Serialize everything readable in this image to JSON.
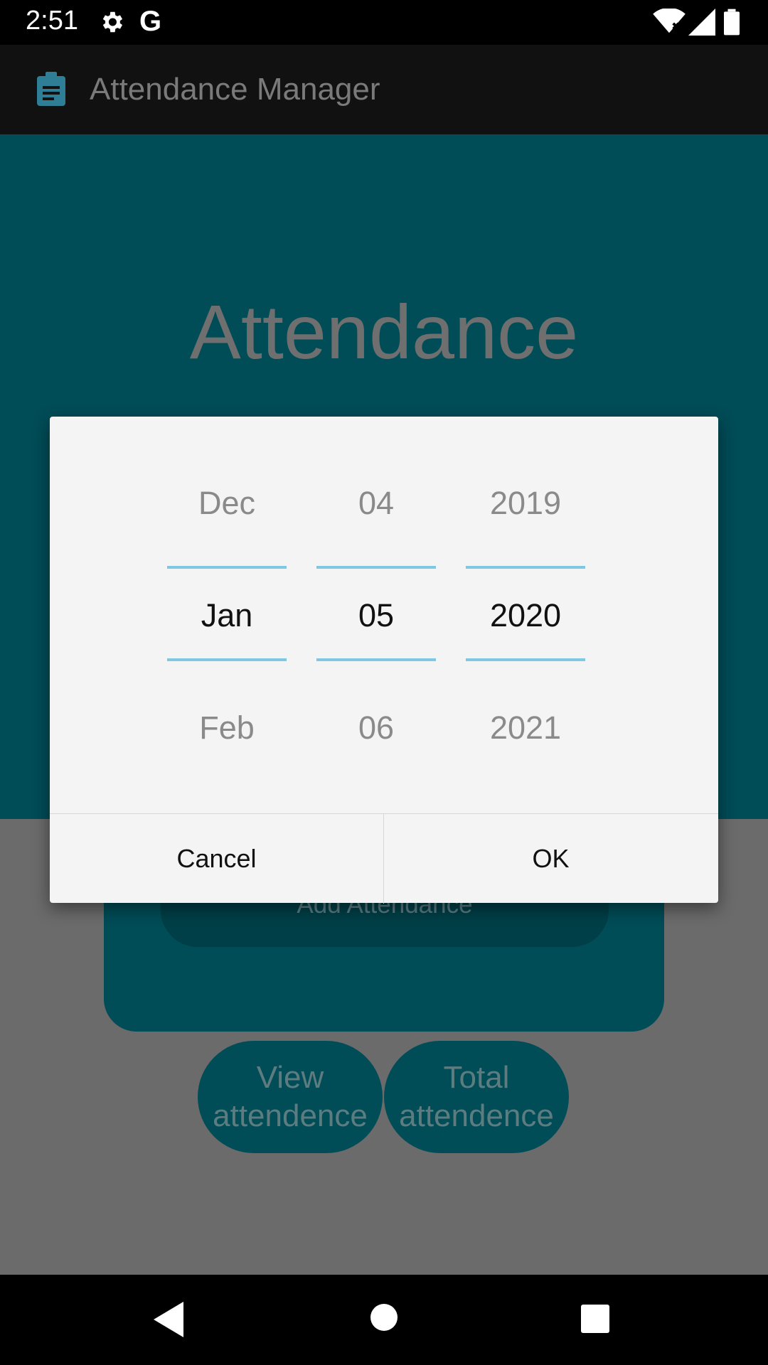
{
  "status_bar": {
    "time": "2:51"
  },
  "app_bar": {
    "title": "Attendance Manager"
  },
  "main": {
    "title": "Attendance",
    "add_button": "Add Attendance",
    "view_button": "View attendence",
    "total_button": "Total attendence"
  },
  "date_picker": {
    "month": {
      "prev": "Dec",
      "selected": "Jan",
      "next": "Feb"
    },
    "day": {
      "prev": "04",
      "selected": "05",
      "next": "06"
    },
    "year": {
      "prev": "2019",
      "selected": "2020",
      "next": "2021"
    },
    "cancel_label": "Cancel",
    "ok_label": "OK"
  },
  "colors": {
    "accent": "#004c57",
    "picker_line": "#7ec8e3"
  }
}
